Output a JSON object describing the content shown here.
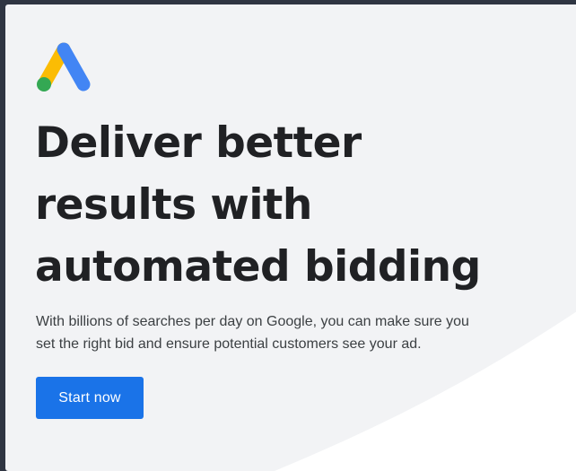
{
  "logo": {
    "icon": "google-ads-logo-icon",
    "colors": {
      "yellow": "#fbbc04",
      "blue": "#4285f4",
      "green": "#34a853"
    }
  },
  "hero": {
    "headline_lines": [
      "Deliver better",
      "results with",
      "automated bidding"
    ],
    "body_lines": [
      "With billions of searches per day on Google, you can make sure you",
      "set the right bid and ensure potential customers see your ad."
    ],
    "cta_label": "Start now"
  },
  "theme": {
    "background": "#f2f3f5",
    "frame_border": "#2f3542",
    "button_color": "#1a73e8",
    "headline_color": "#202124",
    "body_color": "#3c4043"
  }
}
